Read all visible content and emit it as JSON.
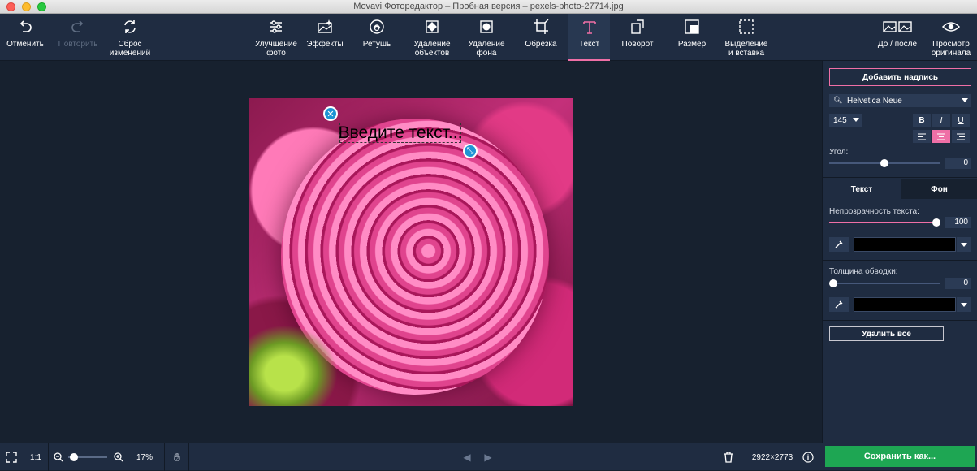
{
  "window": {
    "title": "Movavi Фоторедактор – Пробная версия – pexels-photo-27714.jpg"
  },
  "toolbar": {
    "undo": "Отменить",
    "redo": "Повторить",
    "reset": "Сброс\nизменений",
    "enhance": "Улучшение\nфото",
    "effects": "Эффекты",
    "retouch": "Ретушь",
    "object_removal": "Удаление\nобъектов",
    "bg_removal": "Удаление\nфона",
    "crop": "Обрезка",
    "text": "Текст",
    "rotate": "Поворот",
    "resize": "Размер",
    "select_insert": "Выделение\nи вставка",
    "before_after": "До / после",
    "view_original": "Просмотр\nоригинала"
  },
  "canvas": {
    "text_placeholder": "Введите текст..."
  },
  "panel": {
    "add_caption": "Добавить надпись",
    "font": "Helvetica Neue",
    "font_size": "145",
    "bold": "B",
    "italic": "I",
    "underline": "U",
    "alignment": "center",
    "angle_label": "Угол:",
    "angle_value": "0",
    "angle_fraction": 0.5,
    "tab_text": "Текст",
    "tab_bg": "Фон",
    "opacity_label": "Непрозрачность текста:",
    "opacity_value": "100",
    "opacity_fraction": 1.0,
    "text_color": "#000000",
    "stroke_label": "Толщина обводки:",
    "stroke_value": "0",
    "stroke_fraction": 0.0,
    "stroke_color": "#000000",
    "delete_all": "Удалить все"
  },
  "bottombar": {
    "zoom_1to1": "1:1",
    "zoom": "17%",
    "dimensions": "2922×2773",
    "save": "Сохранить как..."
  },
  "colors": {
    "accent": "#ef6fa6",
    "save": "#1ea653",
    "toolbar": "#1f2c41",
    "canvas": "#17212f"
  }
}
